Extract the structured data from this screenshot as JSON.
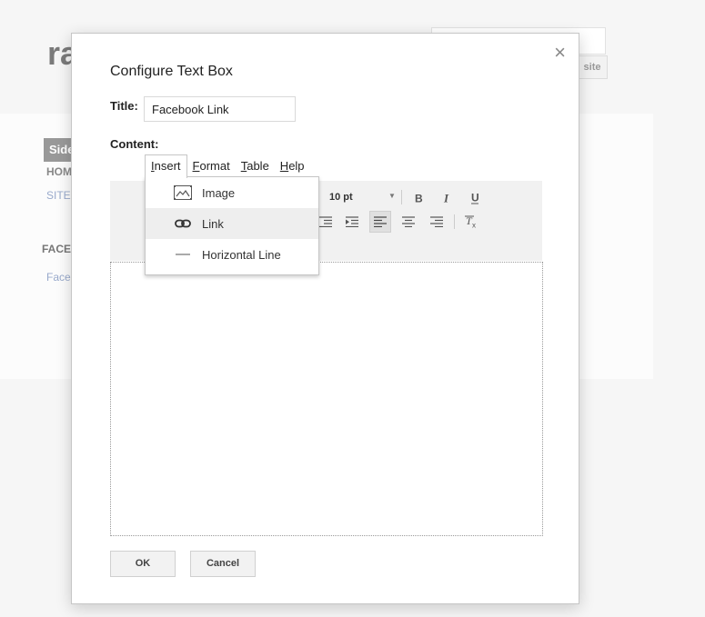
{
  "background": {
    "site_title": "ra",
    "search_button": "site",
    "sidebar_heading": "Side",
    "nav_home": "HOM",
    "nav_sitemap": "SITE",
    "section_heading": "FACE",
    "section_link": "Face"
  },
  "dialog": {
    "title": "Configure Text Box",
    "close_symbol": "×",
    "title_label": "Title:",
    "title_value": "Facebook Link",
    "content_label": "Content:",
    "menus": [
      {
        "accel": "I",
        "rest": "nsert"
      },
      {
        "accel": "F",
        "rest": "ormat"
      },
      {
        "accel": "T",
        "rest": "able"
      },
      {
        "accel": "H",
        "rest": "elp"
      }
    ],
    "insert_menu": [
      {
        "label": "Image",
        "icon": "image-icon"
      },
      {
        "label": "Link",
        "icon": "link-icon"
      },
      {
        "label": "Horizontal Line",
        "icon": "horizontal-line-icon"
      }
    ],
    "font_size": "10 pt",
    "toolbar_icons": [
      "outdent-icon",
      "indent-icon",
      "align-left-icon",
      "align-center-icon",
      "align-right-icon",
      "bold-icon",
      "italic-icon",
      "underline-icon",
      "clear-formatting-icon"
    ],
    "ok_label": "OK",
    "cancel_label": "Cancel"
  },
  "colors": {
    "dialog_border": "#c6c6c6",
    "toolbar_bg": "#f1f1f1",
    "menu_hover": "#eeeeee"
  }
}
